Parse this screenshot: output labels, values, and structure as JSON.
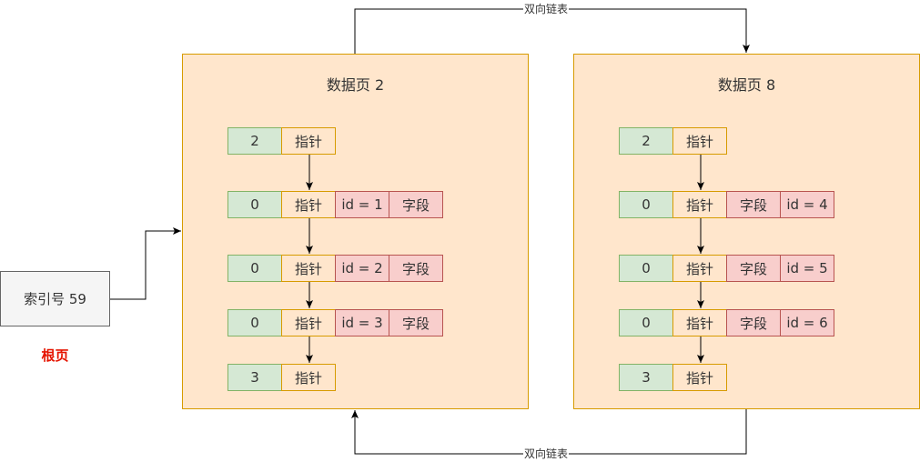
{
  "root": {
    "label": "索引号 59",
    "caption": "根页"
  },
  "links": {
    "top_label": "双向链表",
    "bottom_label": "双向链表"
  },
  "pages": [
    {
      "title": "数据页 2",
      "rows": [
        [
          "2",
          "指针"
        ],
        [
          "0",
          "指针",
          "id = 1",
          "字段"
        ],
        [
          "0",
          "指针",
          "id = 2",
          "字段"
        ],
        [
          "0",
          "指针",
          "id = 3",
          "字段"
        ],
        [
          "3",
          "指针"
        ]
      ]
    },
    {
      "title": "数据页 8",
      "rows": [
        [
          "2",
          "指针"
        ],
        [
          "0",
          "指针",
          "字段",
          "id = 4"
        ],
        [
          "0",
          "指针",
          "字段",
          "id = 5"
        ],
        [
          "0",
          "指针",
          "字段",
          "id = 6"
        ],
        [
          "3",
          "指针"
        ]
      ]
    }
  ],
  "colors": {
    "page_fill": "#ffe6cc",
    "page_border": "#d79b00",
    "num_fill": "#d5e8d4",
    "num_border": "#82b366",
    "field_fill": "#f8cecc",
    "field_border": "#b85450",
    "root_fill": "#f5f5f5",
    "root_border": "#666666",
    "root_caption": "#e51400"
  }
}
